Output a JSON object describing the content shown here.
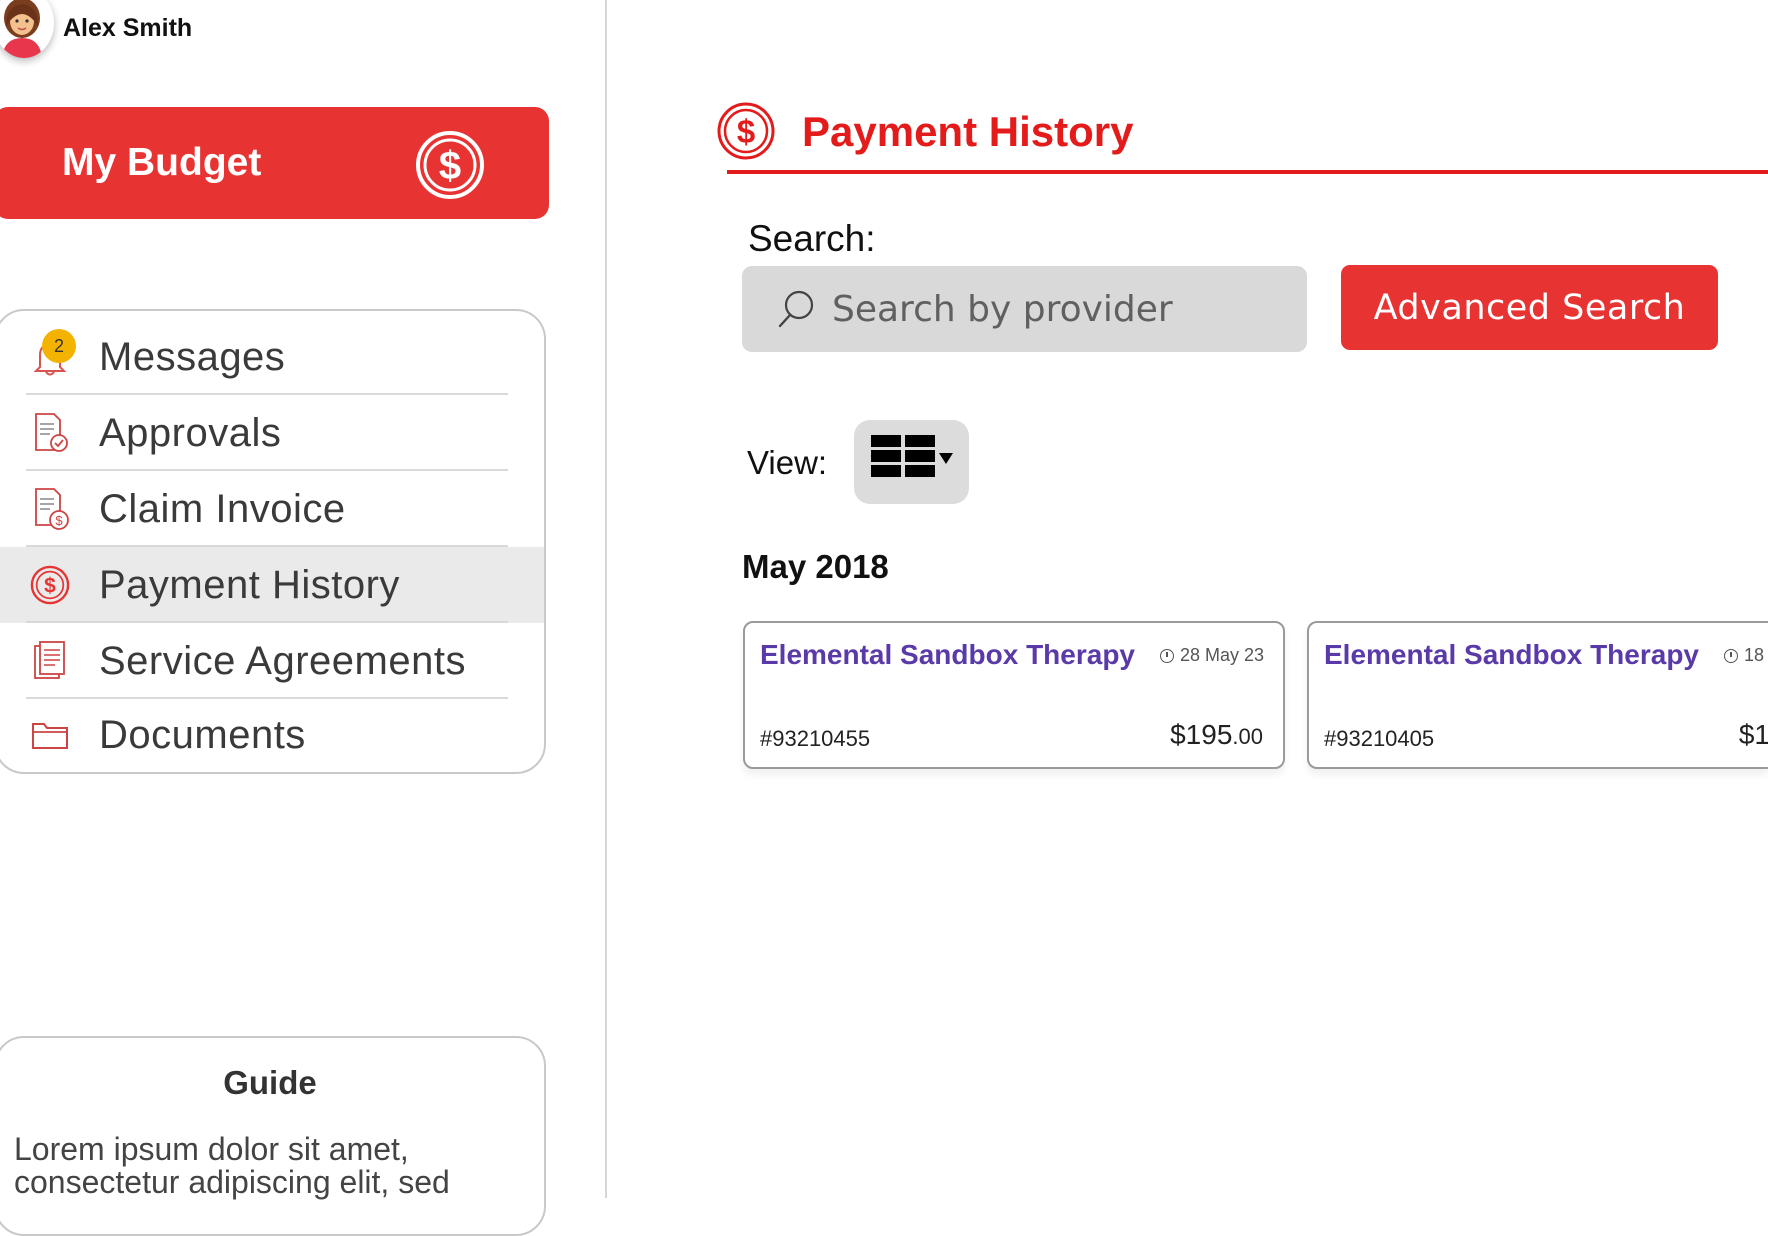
{
  "user": {
    "name": "Alex Smith"
  },
  "budget": {
    "label": "My Budget"
  },
  "nav": {
    "items": [
      {
        "label": "Messages",
        "badge": "2",
        "icon": "bell-icon"
      },
      {
        "label": "Approvals",
        "icon": "document-check-icon"
      },
      {
        "label": "Claim Invoice",
        "icon": "invoice-dollar-icon"
      },
      {
        "label": "Payment History",
        "icon": "dollar-circle-icon",
        "active": true
      },
      {
        "label": "Service Agreements",
        "icon": "agreement-document-icon"
      },
      {
        "label": "Documents",
        "icon": "folder-icon"
      }
    ]
  },
  "guide": {
    "title": "Guide",
    "text": "Lorem ipsum dolor sit amet, consectetur adipiscing elit, sed"
  },
  "page": {
    "title": "Payment History"
  },
  "search": {
    "label": "Search:",
    "placeholder": "Search by provider",
    "value": "",
    "advanced_label": "Advanced Search"
  },
  "view": {
    "label": "View:",
    "mode_icon": "grid-view-icon"
  },
  "groups": [
    {
      "month": "May 2018",
      "payments": [
        {
          "provider": "Elemental Sandbox Therapy",
          "date": "28 May 23",
          "ref": "#93210455",
          "amount_main": "$195",
          "amount_cents": ".00"
        },
        {
          "provider": "Elemental Sandbox Therapy",
          "date": "18",
          "ref": "#93210405",
          "amount_main": "$1",
          "amount_cents": ""
        }
      ]
    }
  ],
  "colors": {
    "accent": "#e83333",
    "title_red": "#e31b1b",
    "provider_purple": "#5a3aa8",
    "badge": "#f5b301"
  }
}
